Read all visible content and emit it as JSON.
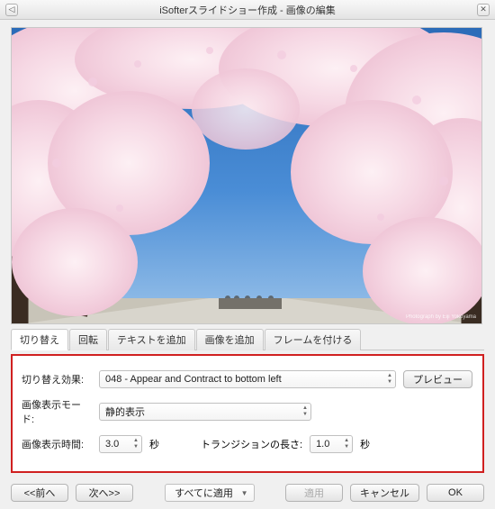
{
  "window": {
    "title": "iSofterスライドショー作成 - 画像の編集"
  },
  "tabs": [
    {
      "label": "切り替え"
    },
    {
      "label": "回転"
    },
    {
      "label": "テキストを追加"
    },
    {
      "label": "画像を追加"
    },
    {
      "label": "フレームを付ける"
    }
  ],
  "panel": {
    "effect_label": "切り替え効果:",
    "effect_value": "048 - Appear and Contract to bottom left",
    "preview_btn": "プレビュー",
    "mode_label": "画像表示モード:",
    "mode_value": "静的表示",
    "duration_label": "画像表示時間:",
    "duration_value": "3.0",
    "duration_unit": "秒",
    "transition_label": "トランジションの長さ:",
    "transition_value": "1.0",
    "transition_unit": "秒"
  },
  "footer": {
    "prev": "<<前へ",
    "next": "次へ>>",
    "apply_all": "すべてに適用",
    "apply": "適用",
    "cancel": "キャンセル",
    "ok": "OK"
  }
}
